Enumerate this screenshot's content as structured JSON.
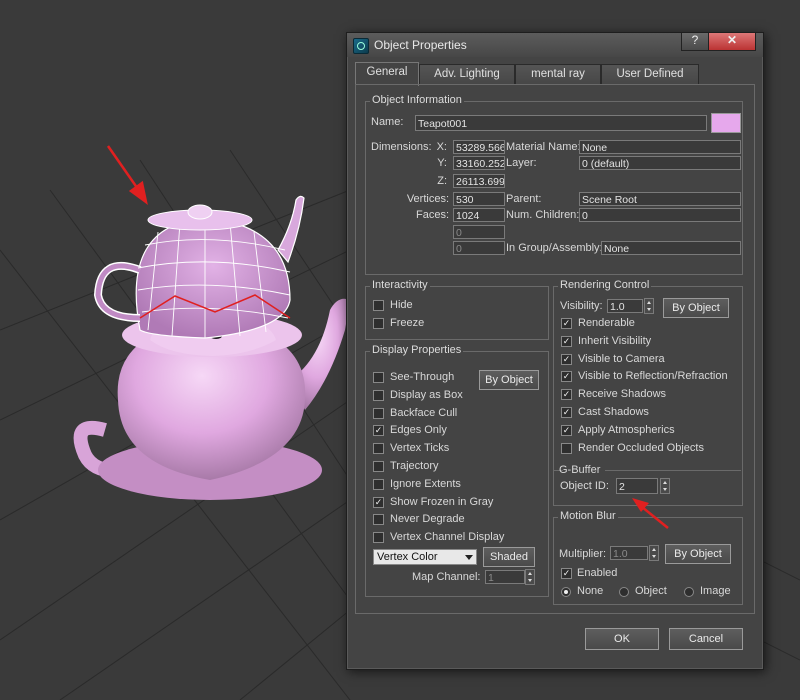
{
  "colors": {
    "wire": "#ffffff",
    "teapot": "#e6b0e6",
    "accent": "#e02020",
    "swatch": "#e6a8ec"
  },
  "dialog": {
    "title": "Object Properties",
    "help_glyph": "?",
    "close_glyph": "✕",
    "tabs": [
      {
        "label": "General",
        "active": true
      },
      {
        "label": "Adv. Lighting"
      },
      {
        "label": "mental ray"
      },
      {
        "label": "User Defined"
      }
    ],
    "object_info": {
      "group_label": "Object Information",
      "name_label": "Name:",
      "name_value": "Teapot001",
      "dimensions_label": "Dimensions:",
      "x_label": "X:",
      "x_value": "53289.566",
      "y_label": "Y:",
      "y_value": "33160.252",
      "z_label": "Z:",
      "z_value": "26113.699",
      "vertices_label": "Vertices:",
      "vertices_value": "530",
      "faces_label": "Faces:",
      "faces_value": "1024",
      "extra1_value": "0",
      "extra2_value": "0",
      "material_label": "Material Name:",
      "material_value": "None",
      "layer_label": "Layer:",
      "layer_value": "0 (default)",
      "parent_label": "Parent:",
      "parent_value": "Scene Root",
      "children_label": "Num. Children:",
      "children_value": "0",
      "group_assembly_label": "In Group/Assembly:",
      "group_assembly_value": "None"
    },
    "interactivity": {
      "group_label": "Interactivity",
      "hide": {
        "label": "Hide",
        "checked": false
      },
      "freeze": {
        "label": "Freeze",
        "checked": false
      }
    },
    "display_properties": {
      "group_label": "Display Properties",
      "by_object_label": "By Object",
      "items": [
        {
          "label": "See-Through",
          "checked": false
        },
        {
          "label": "Display as Box",
          "checked": false
        },
        {
          "label": "Backface Cull",
          "checked": false
        },
        {
          "label": "Edges Only",
          "checked": true
        },
        {
          "label": "Vertex Ticks",
          "checked": false
        },
        {
          "label": "Trajectory",
          "checked": false
        },
        {
          "label": "Ignore Extents",
          "checked": false
        },
        {
          "label": "Show Frozen in Gray",
          "checked": true
        },
        {
          "label": "Never Degrade",
          "checked": false
        },
        {
          "label": "Vertex Channel Display",
          "checked": false
        }
      ],
      "vertex_color_value": "Vertex Color",
      "shaded_label": "Shaded",
      "map_channel_label": "Map Channel:",
      "map_channel_value": "1"
    },
    "rendering_control": {
      "group_label": "Rendering Control",
      "visibility_label": "Visibility:",
      "visibility_value": "1.0",
      "by_object_label": "By Object",
      "items": [
        {
          "label": "Renderable",
          "checked": true
        },
        {
          "label": "Inherit Visibility",
          "checked": true
        },
        {
          "label": "Visible to Camera",
          "checked": true
        },
        {
          "label": "Visible to Reflection/Refraction",
          "checked": true
        },
        {
          "label": "Receive Shadows",
          "checked": true
        },
        {
          "label": "Cast Shadows",
          "checked": true
        },
        {
          "label": "Apply Atmospherics",
          "checked": true
        },
        {
          "label": "Render Occluded Objects",
          "checked": false
        }
      ]
    },
    "gbuffer": {
      "group_label": "G-Buffer",
      "object_id_label": "Object ID:",
      "object_id_value": "2"
    },
    "motion_blur": {
      "group_label": "Motion Blur",
      "multiplier_label": "Multiplier:",
      "multiplier_value": "1.0",
      "by_object_label": "By Object",
      "enabled": {
        "label": "Enabled",
        "checked": true
      },
      "radio_none": "None",
      "radio_object": "Object",
      "radio_image": "Image"
    },
    "ok_label": "OK",
    "cancel_label": "Cancel"
  }
}
